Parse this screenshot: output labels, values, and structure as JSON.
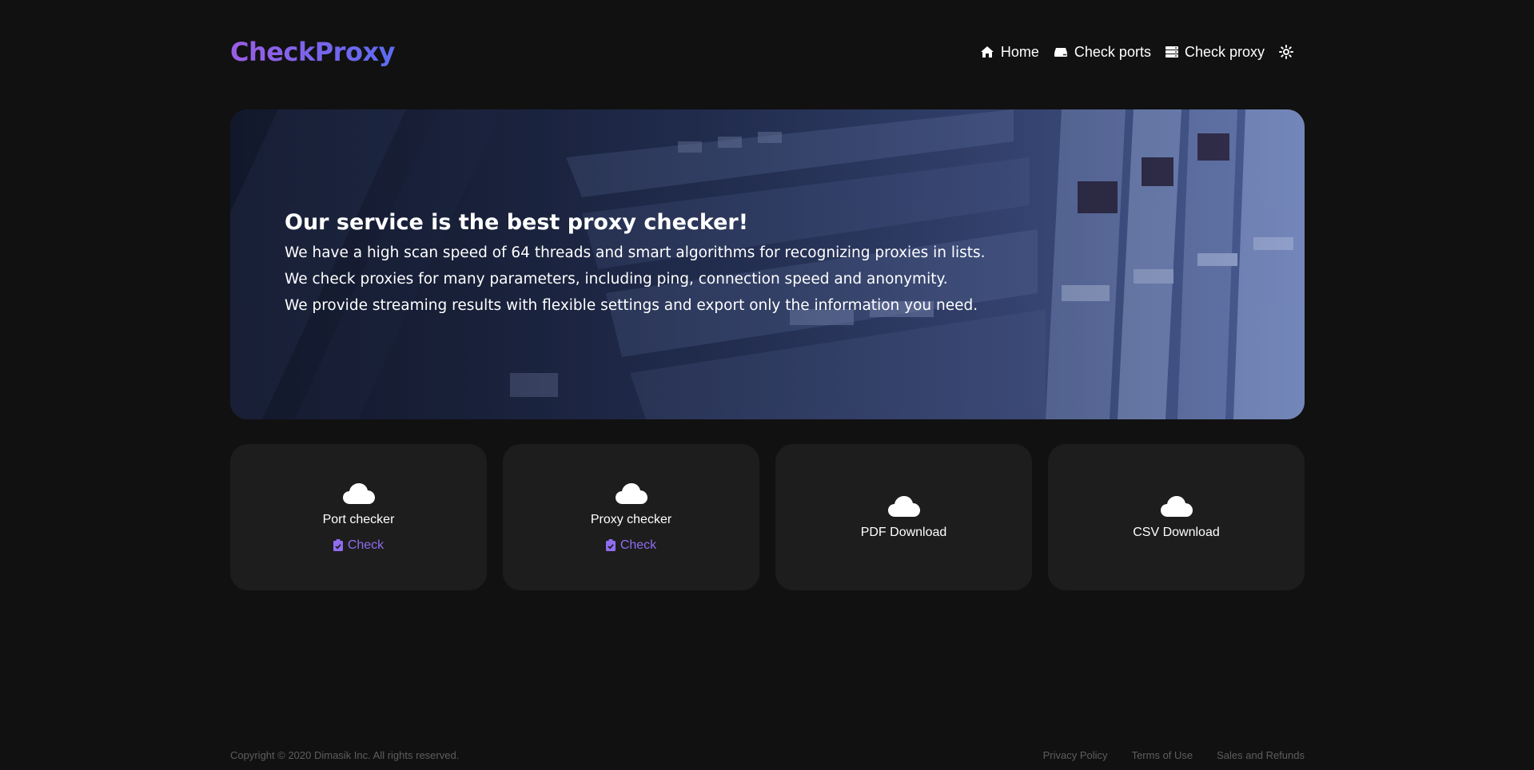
{
  "header": {
    "logo": "CheckProxy",
    "nav": [
      {
        "label": "Home",
        "icon": "home-icon"
      },
      {
        "label": "Check ports",
        "icon": "hdd-icon"
      },
      {
        "label": "Check proxy",
        "icon": "server-icon"
      }
    ],
    "theme_toggle_icon": "sun-icon"
  },
  "hero": {
    "title": "Our service is the best proxy checker!",
    "lines": [
      "We have a high scan speed of 64 threads and smart algorithms for recognizing proxies in lists.",
      "We check proxies for many parameters, including ping, connection speed and anonymity.",
      "We provide streaming results with flexible settings and export only the information you need."
    ]
  },
  "cards": [
    {
      "title": "Port checker",
      "link": "Check",
      "icon": "cloud-icon",
      "link_icon": "clipboard-check-icon"
    },
    {
      "title": "Proxy checker",
      "link": "Check",
      "icon": "cloud-icon",
      "link_icon": "clipboard-check-icon"
    },
    {
      "title": "PDF Download",
      "icon": "cloud-icon"
    },
    {
      "title": "CSV Download",
      "icon": "cloud-icon"
    }
  ],
  "footer": {
    "copyright": "Copyright © 2020 Dimasik Inc. All rights reserved.",
    "links": [
      "Privacy Policy",
      "Terms of Use",
      "Sales and Refunds"
    ]
  },
  "colors": {
    "background": "#111111",
    "card": "#1d1d1d",
    "accent": "#8f6cf0",
    "logo_gradient_start": "#9b5de5",
    "logo_gradient_end": "#5b6cf0"
  }
}
